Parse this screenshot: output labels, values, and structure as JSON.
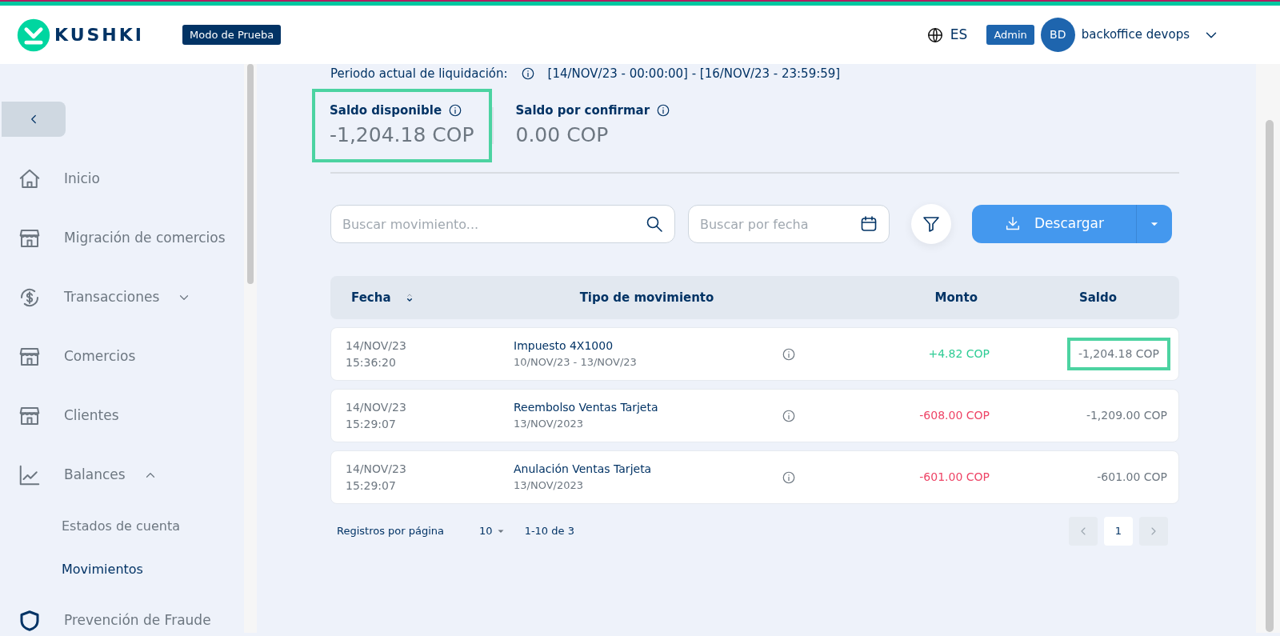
{
  "header": {
    "brand": "KUSHKI",
    "mode_badge": "Modo de Prueba",
    "language": "ES",
    "role_badge": "Admin",
    "avatar_initials": "BD",
    "user_name": "backoffice devops"
  },
  "sidebar": {
    "items": [
      {
        "label": "Inicio",
        "selected": false
      },
      {
        "label": "Migración de comercios",
        "selected": false
      },
      {
        "label": "Transacciones",
        "selected": false,
        "expanded": false
      },
      {
        "label": "Comercios",
        "selected": false
      },
      {
        "label": "Clientes",
        "selected": false
      },
      {
        "label": "Balances",
        "selected": false,
        "expanded": true,
        "children": [
          {
            "label": "Estados de cuenta",
            "selected": false
          },
          {
            "label": "Movimientos",
            "selected": true
          }
        ]
      },
      {
        "label": "Prevención de Fraude",
        "selected": false
      }
    ]
  },
  "period": {
    "label": "Periodo actual de liquidación:",
    "value": "[14/NOV/23 - 00:00:00] - [16/NOV/23 - 23:59:59]"
  },
  "balances": [
    {
      "label": "Saldo disponible",
      "value": "-1,204.18 COP",
      "highlighted": true
    },
    {
      "label": "Saldo por confirmar",
      "value": "0.00 COP",
      "highlighted": false
    }
  ],
  "search": {
    "placeholder": "Buscar movimiento..."
  },
  "date_search": {
    "placeholder": "Buscar por fecha"
  },
  "download_button": "Descargar",
  "table": {
    "columns": [
      "Fecha",
      "Tipo de movimiento",
      "Monto",
      "Saldo"
    ],
    "rows": [
      {
        "date": "14/NOV/23",
        "time": "15:36:20",
        "type": "Impuesto 4X1000",
        "detail": "10/NOV/23 - 13/NOV/23",
        "amount": "+4.82 COP",
        "color": "#2ecc95",
        "balance": "-1,204.18 COP",
        "balance_highlighted": true
      },
      {
        "date": "14/NOV/23",
        "time": "15:29:07",
        "type": "Reembolso Ventas Tarjeta",
        "detail": "13/NOV/2023",
        "amount": "-608.00 COP",
        "color": "#ee4466",
        "balance": "-1,209.00 COP",
        "balance_highlighted": false
      },
      {
        "date": "14/NOV/23",
        "time": "15:29:07",
        "type": "Anulación Ventas Tarjeta",
        "detail": "13/NOV/2023",
        "amount": "-601.00 COP",
        "color": "#ee4466",
        "balance": "-601.00 COP",
        "balance_highlighted": false
      }
    ]
  },
  "pagination": {
    "rows_label": "Registros por página",
    "rows_per_page": "10",
    "range": "1-10 de 3",
    "pages": [
      {
        "label": "1",
        "selected": true
      }
    ]
  }
}
